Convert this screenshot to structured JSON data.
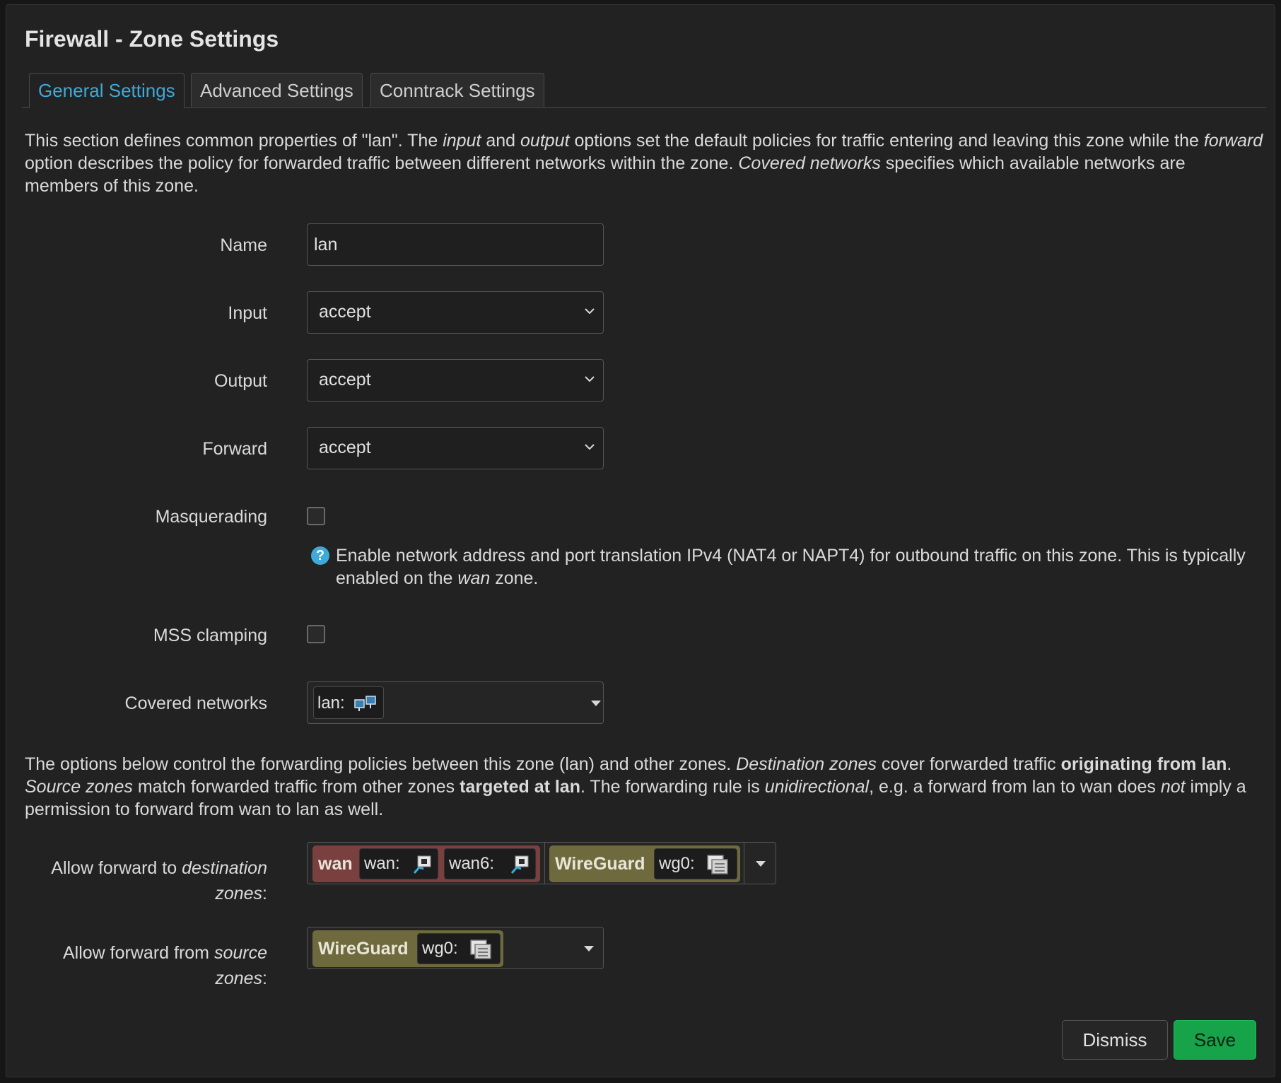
{
  "dialog": {
    "title": "Firewall - Zone Settings"
  },
  "tabs": [
    {
      "label": "General Settings",
      "active": true
    },
    {
      "label": "Advanced Settings",
      "active": false
    },
    {
      "label": "Conntrack Settings",
      "active": false
    }
  ],
  "intro": {
    "t1": "This section defines common properties of \"lan\". The ",
    "i1": "input",
    "t2": " and ",
    "i2": "output",
    "t3": " options set the default policies for traffic entering and leaving this zone while the ",
    "i3": "forward",
    "t4": " option describes the policy for forwarded traffic between different networks within the zone. ",
    "i4": "Covered networks",
    "t5": " specifies which available networks are members of this zone."
  },
  "fields": {
    "name": {
      "label": "Name",
      "value": "lan"
    },
    "input": {
      "label": "Input",
      "value": "accept"
    },
    "output": {
      "label": "Output",
      "value": "accept"
    },
    "forward": {
      "label": "Forward",
      "value": "accept"
    },
    "masquerading": {
      "label": "Masquerading",
      "checked": false,
      "help_t1": "Enable network address and port translation IPv4 (NAT4 or NAPT4) for outbound traffic on this zone. This is typically enabled on the ",
      "help_i1": "wan",
      "help_t2": " zone."
    },
    "mss_clamping": {
      "label": "MSS clamping",
      "checked": false
    },
    "covered_networks": {
      "label": "Covered networks",
      "chip": "lan:"
    }
  },
  "forwarding_desc": {
    "t1": "The options below control the forwarding policies between this zone (lan) and other zones. ",
    "i1": "Destination zones",
    "t2": " cover forwarded traffic ",
    "b1": "originating from lan",
    "t3": ". ",
    "i2": "Source zones",
    "t4": " match forwarded traffic from other zones ",
    "b2": "targeted at lan",
    "t5": ". The forwarding rule is ",
    "i3": "unidirectional",
    "t6": ", e.g. a forward from lan to wan does ",
    "i4": "not",
    "t7": " imply a permission to forward from wan to lan as well."
  },
  "dest_zones": {
    "label_t1": "Allow forward to ",
    "label_i1": "destination zones",
    "label_t2": ":",
    "zones": [
      {
        "name": "wan",
        "color": "#7a3f3f",
        "devices": [
          "wan:",
          "wan6:"
        ]
      },
      {
        "name": "WireGuard",
        "color": "#6f6a3e",
        "devices": [
          "wg0:"
        ]
      }
    ]
  },
  "src_zones": {
    "label_t1": "Allow forward from ",
    "label_i1": "source zones",
    "label_t2": ":",
    "zones": [
      {
        "name": "WireGuard",
        "color": "#6f6a3e",
        "devices": [
          "wg0:"
        ]
      }
    ]
  },
  "buttons": {
    "dismiss": "Dismiss",
    "save": "Save"
  },
  "colors": {
    "accent": "#3fa9d8",
    "save": "#16a34a",
    "wan_zone": "#7a3f3f",
    "wireguard_zone": "#6f6a3e"
  },
  "icons": {
    "ethernet": "ethernet-port-icon",
    "bridge": "bridge-icon",
    "tunnel": "tunnel-icon",
    "help": "help-icon",
    "chevron": "chevron-down-icon"
  }
}
